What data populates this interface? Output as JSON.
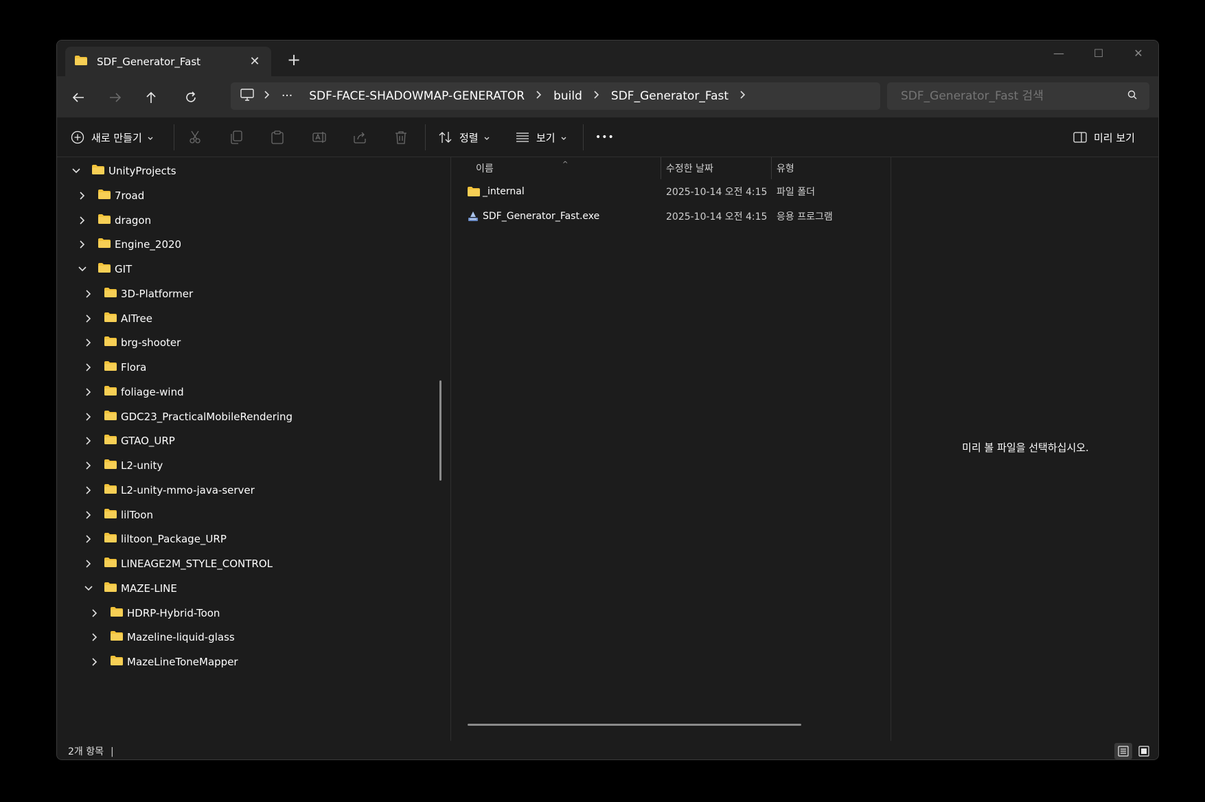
{
  "tab": {
    "title": "SDF_Generator_Fast",
    "close": "✕",
    "new": "+"
  },
  "window_controls": {
    "minimize": "—",
    "maximize": "☐",
    "close": "✕"
  },
  "address": {
    "more": "···",
    "segments": [
      "SDF-FACE-SHADOWMAP-GENERATOR",
      "build",
      "SDF_Generator_Fast"
    ]
  },
  "search": {
    "placeholder": "SDF_Generator_Fast 검색"
  },
  "toolbar": {
    "new_label": "새로 만들기",
    "sort_label": "정렬",
    "view_label": "보기",
    "more": "•••",
    "preview_label": "미리 보기"
  },
  "sidebar": {
    "items": [
      {
        "label": "UnityProjects",
        "expanded": true
      },
      {
        "label": "7road",
        "expanded": false
      },
      {
        "label": "dragon",
        "expanded": false
      },
      {
        "label": "Engine_2020",
        "expanded": false
      },
      {
        "label": "GIT",
        "expanded": true
      },
      {
        "label": "3D-Platformer",
        "expanded": false
      },
      {
        "label": "AITree",
        "expanded": false
      },
      {
        "label": "brg-shooter",
        "expanded": false
      },
      {
        "label": "Flora",
        "expanded": false
      },
      {
        "label": "foliage-wind",
        "expanded": false
      },
      {
        "label": "GDC23_PracticalMobileRendering",
        "expanded": false
      },
      {
        "label": "GTAO_URP",
        "expanded": false
      },
      {
        "label": "L2-unity",
        "expanded": false
      },
      {
        "label": "L2-unity-mmo-java-server",
        "expanded": false
      },
      {
        "label": "lilToon",
        "expanded": false
      },
      {
        "label": "liltoon_Package_URP",
        "expanded": false
      },
      {
        "label": "LINEAGE2M_STYLE_CONTROL",
        "expanded": false
      },
      {
        "label": "MAZE-LINE",
        "expanded": true
      },
      {
        "label": "HDRP-Hybrid-Toon",
        "expanded": false
      },
      {
        "label": "Mazeline-liquid-glass",
        "expanded": false
      },
      {
        "label": "MazeLineToneMapper",
        "expanded": false
      }
    ]
  },
  "filelist": {
    "columns": {
      "name": "이름",
      "date": "수정한 날짜",
      "type": "유형"
    },
    "rows": [
      {
        "name": "_internal",
        "date": "2025-10-14 오전 4:15",
        "type": "파일 폴더",
        "icon": "folder-icon"
      },
      {
        "name": "SDF_Generator_Fast.exe",
        "date": "2025-10-14 오전 4:15",
        "type": "응용 프로그램",
        "icon": "exe-icon"
      }
    ]
  },
  "preview": {
    "message": "미리 볼 파일을 선택하십시오."
  },
  "status": {
    "count": "2개 항목"
  },
  "colors": {
    "folder": "#f2c23a",
    "background": "#1c1c1c",
    "titlebar": "#202020",
    "tab": "#2c2c2c"
  }
}
